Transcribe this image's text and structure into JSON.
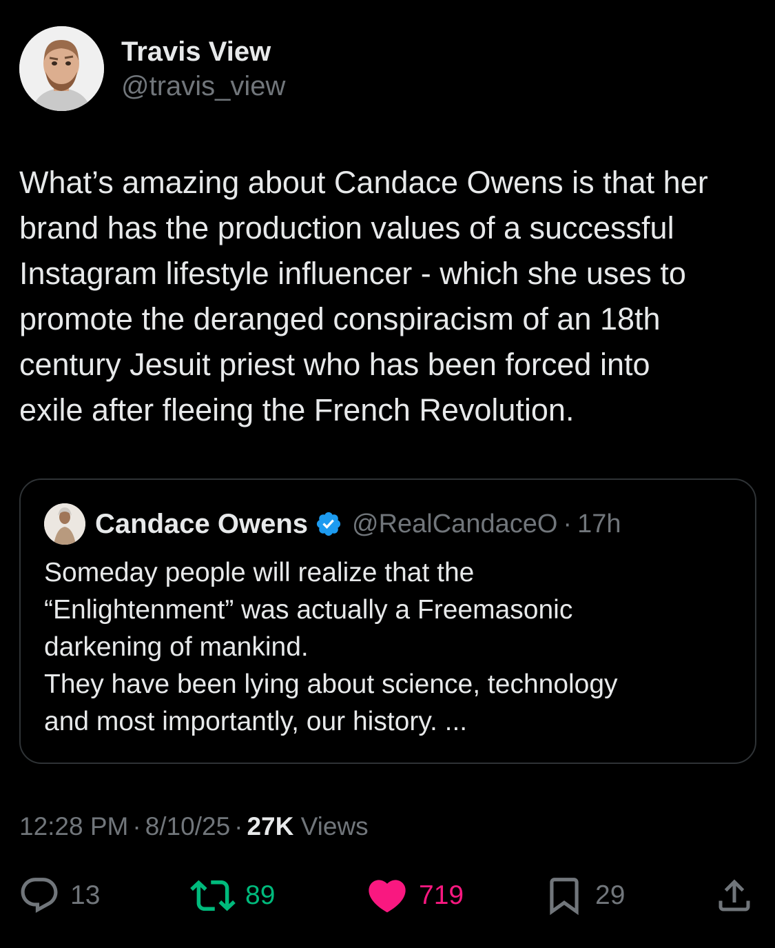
{
  "tweet": {
    "author": {
      "display_name": "Travis View",
      "handle": "@travis_view"
    },
    "text": "What’s amazing about Candace Owens is that her\nbrand has the production values of a successful\nInstagram lifestyle influencer - which she uses to\npromote the deranged conspiracism of an 18th\ncentury Jesuit priest who has been forced into\nexile after fleeing the French Revolution.",
    "quote": {
      "display_name": "Candace Owens",
      "handle": "@RealCandaceO",
      "separator": "·",
      "time": "17h",
      "verified": true,
      "text": "Someday people will realize that the\n“Enlightenment” was actually a Freemasonic\ndarkening of mankind.\nThey have been lying about science, technology\nand most importantly, our history. ..."
    },
    "meta": {
      "time": "12:28 PM",
      "date": "8/10/25",
      "separator": "·",
      "views_count": "27K",
      "views_label": "Views"
    },
    "actions": {
      "replies": "13",
      "retweets": "89",
      "likes": "719",
      "bookmarks": "29"
    }
  },
  "colors": {
    "background": "#000000",
    "text": "#e7e9ea",
    "secondary": "#71767b",
    "border": "#2f3336",
    "retweet": "#00ba7c",
    "like": "#f91880",
    "verified": "#1d9bf0"
  },
  "icons": [
    "reply-icon",
    "retweet-icon",
    "heart-icon",
    "bookmark-icon",
    "share-icon",
    "verified-badge-icon"
  ]
}
